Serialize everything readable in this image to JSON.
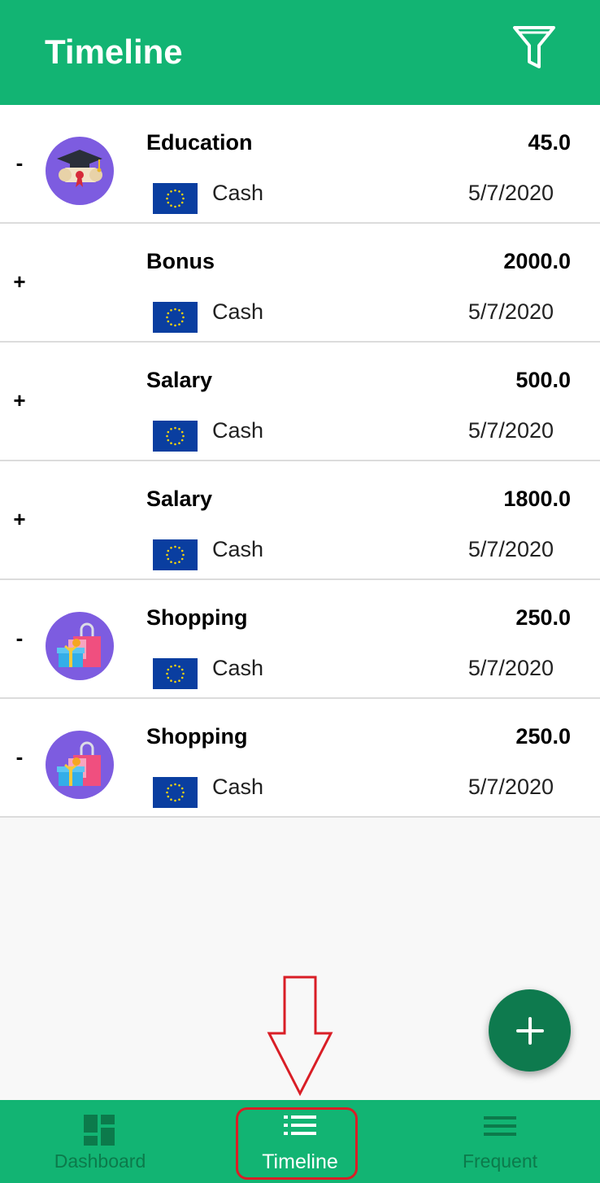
{
  "appbar": {
    "title": "Timeline",
    "filter_icon": "filter-icon"
  },
  "transactions": [
    {
      "sign": "-",
      "category": "Education",
      "amount": "45.0",
      "account": "Cash",
      "date": "5/7/2020",
      "icon": "graduation-icon"
    },
    {
      "sign": "+",
      "category": "Bonus",
      "amount": "2000.0",
      "account": "Cash",
      "date": "5/7/2020",
      "icon": ""
    },
    {
      "sign": "+",
      "category": "Salary",
      "amount": "500.0",
      "account": "Cash",
      "date": "5/7/2020",
      "icon": ""
    },
    {
      "sign": "+",
      "category": "Salary",
      "amount": "1800.0",
      "account": "Cash",
      "date": "5/7/2020",
      "icon": ""
    },
    {
      "sign": "-",
      "category": "Shopping",
      "amount": "250.0",
      "account": "Cash",
      "date": "5/7/2020",
      "icon": "shopping-icon"
    },
    {
      "sign": "-",
      "category": "Shopping",
      "amount": "250.0",
      "account": "Cash",
      "date": "5/7/2020",
      "icon": "shopping-icon"
    }
  ],
  "fab": {
    "icon": "plus-icon"
  },
  "bottom_nav": [
    {
      "label": "Dashboard",
      "icon": "dashboard-icon",
      "active": false
    },
    {
      "label": "Timeline",
      "icon": "list-icon",
      "active": true
    },
    {
      "label": "Frequent",
      "icon": "menu-icon",
      "active": false
    }
  ],
  "colors": {
    "primary": "#12b473",
    "primary_dark": "#0e7a4e",
    "avatar": "#7d5ce0",
    "flag_blue": "#0a3ea0",
    "annotation": "#d91e26"
  }
}
